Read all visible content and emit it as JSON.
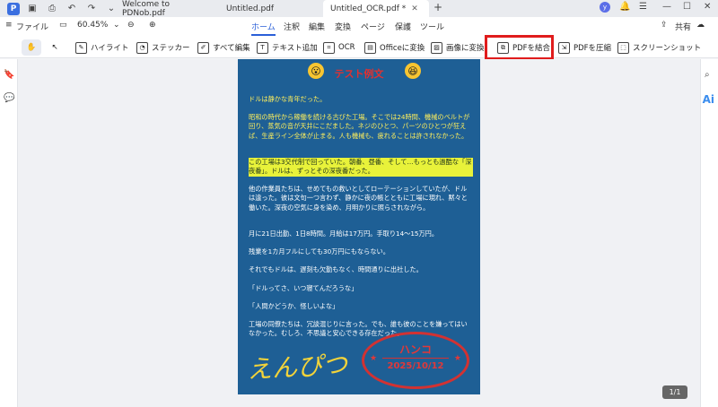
{
  "tabs": [
    {
      "title": "Welcome to PDNob.pdf",
      "active": false
    },
    {
      "title": "Untitled.pdf",
      "active": false
    },
    {
      "title": "Untitled_OCR.pdf *",
      "active": true
    }
  ],
  "menu": {
    "file": "ファイル",
    "zoom": "60.45%",
    "items": [
      "ホーム",
      "注釈",
      "編集",
      "変換",
      "ページ",
      "保護",
      "ツール"
    ],
    "share": "共有"
  },
  "toolbar": {
    "highlight": "ハイライト",
    "sticker": "ステッカー",
    "edit_all": "すべて編集",
    "add_text": "テキスト追加",
    "ocr": "OCR",
    "to_office": "Officeに変換",
    "to_image": "画像に変換",
    "merge_pdf": "PDFを結合",
    "compress_pdf": "PDFを圧縮",
    "screenshot": "スクリーンショット"
  },
  "document": {
    "title": "テスト例文",
    "paragraphs": [
      "ドルは静かな青年だった。",
      "昭和の時代から稼働を続ける古びた工場。そこでは24時間、機械のベルトが回り、蒸気の音が天井にこだました。ネジのひとつ、パーツのひとつが狂えば、生産ライン全体が止まる。人も機械も、疲れることは許されなかった。",
      "この工場は3交代制で回っていた。朝番、昼番、そして…もっとも過酷な「深夜番」。ドルは、ずっとその深夜番だった。",
      "他の作業員たちは、せめてもの救いとしてローテーションしていたが、ドルは違った。彼は文句一つ言わず、静かに夜の帳とともに工場に現れ、黙々と働いた。深夜の空気に身を染め、月明かりに照らされながら。",
      "月に21日出勤、1日8時間。月給は17万円。手取り14～15万円。",
      "残業を1カ月フルにしても30万円にもならない。",
      "それでもドルは、遅刻も欠勤もなく、時間通りに出社した。",
      "「ドルってさ、いつ寝てんだろうな」",
      "「人間かどうか、怪しいよな」",
      "工場の同僚たちは、冗談混じりに言った。でも、誰も彼のことを嫌ってはいなかった。むしろ、不思議と安心できる存在だった。"
    ],
    "signature": "えんぴつ",
    "stamp_name": "ハンコ",
    "stamp_date": "2025/10/12"
  },
  "page_indicator": "1/1",
  "colors": {
    "page_bg": "#1e5f95",
    "text_yellow": "#ffef5c",
    "highlight": "#e8f23a",
    "stamp_red": "#d23232",
    "callout_red": "#e01c1c"
  }
}
